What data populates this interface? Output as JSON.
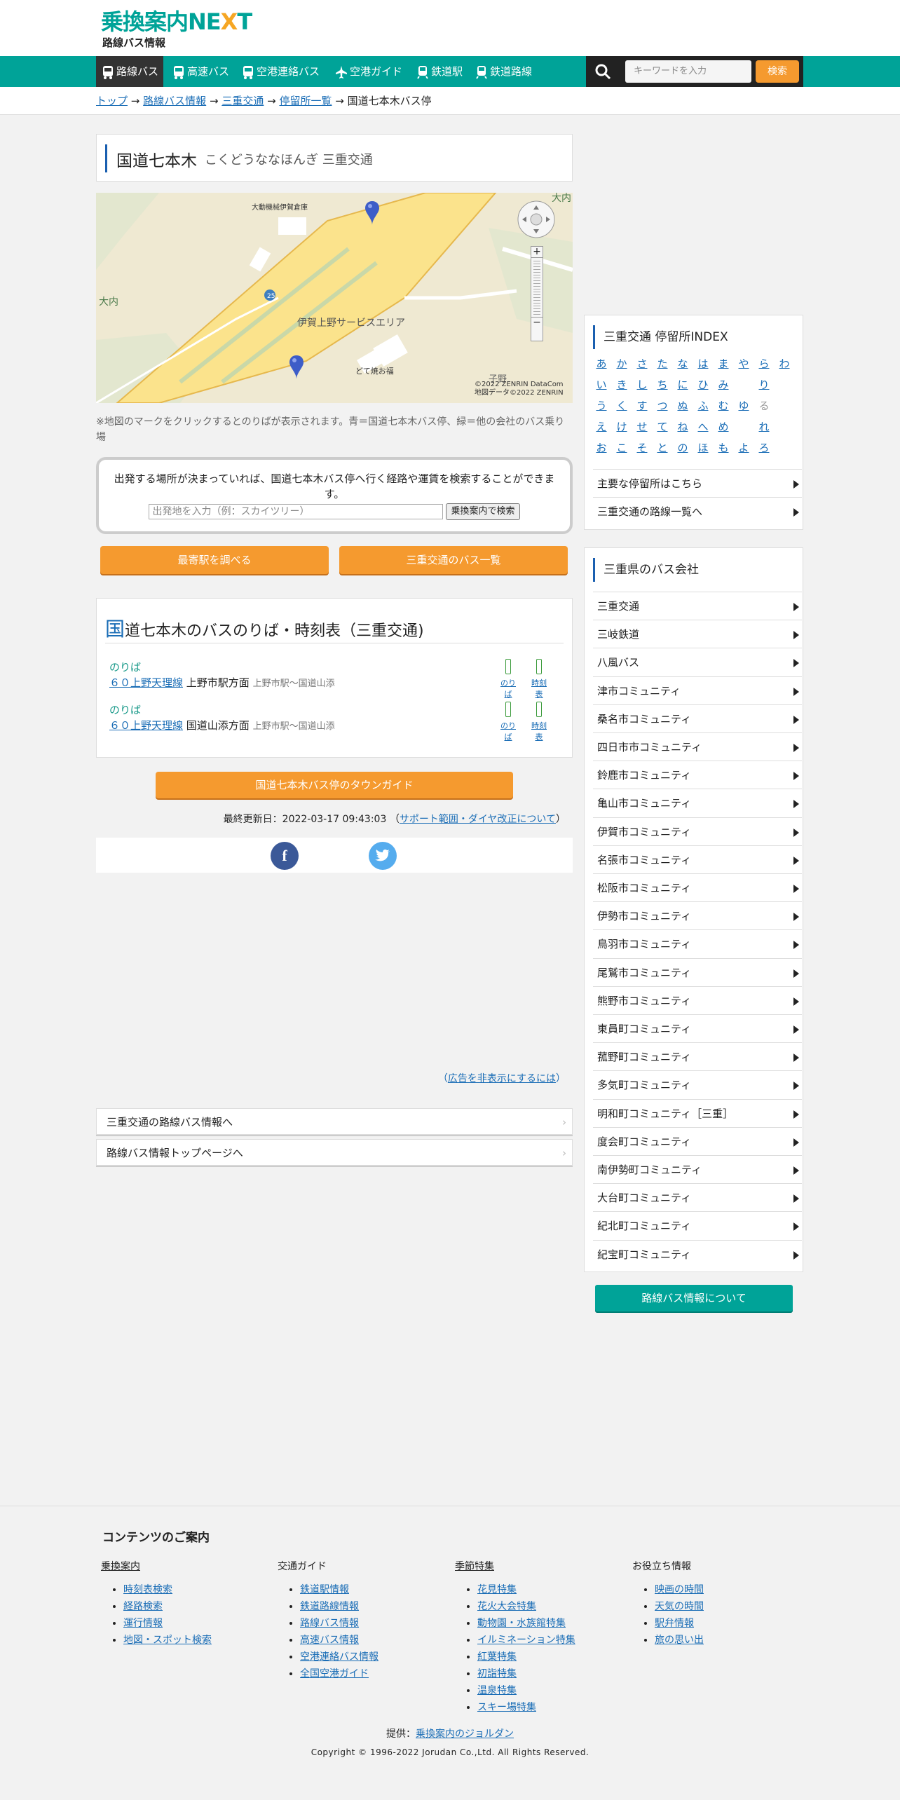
{
  "header": {
    "logo_text": "乗換案内",
    "logo_next": "NE",
    "logo_x": "X",
    "logo_t": "T",
    "subtitle": "路線バス情報"
  },
  "nav": {
    "items": [
      {
        "label": "路線バス",
        "icon": "bus-icon"
      },
      {
        "label": "高速バス",
        "icon": "highway-bus-icon"
      },
      {
        "label": "空港連絡バス",
        "icon": "airport-bus-icon"
      },
      {
        "label": "空港ガイド",
        "icon": "airplane-icon"
      },
      {
        "label": "鉄道駅",
        "icon": "train-icon"
      },
      {
        "label": "鉄道路線",
        "icon": "rail-line-icon"
      }
    ],
    "search_placeholder": "キーワードを入力",
    "search_button": "検索"
  },
  "breadcrumb": {
    "items": [
      "トップ",
      "路線バス情報",
      "三重交通",
      "停留所一覧"
    ],
    "sep": "→",
    "current": "国道七本木バス停"
  },
  "stop": {
    "name": "国道七本木",
    "reading": "こくどうななほんぎ 三重交通"
  },
  "map": {
    "labels": [
      "大内",
      "大内",
      "大動機械伊賀倉庫",
      "伊賀上野サービスエリア",
      "どて焼お福",
      "25",
      "子野"
    ],
    "copyright1": "©2022 ZENRIN DataCom",
    "copyright2": "地図データ©2022 ZENRIN"
  },
  "map_note": "※地図のマークをクリックするとのりばが表示されます。青＝国道七本木バス停、緑＝他の会社のバス乗り場",
  "route_search": {
    "message": "出発する場所が決まっていれば、国道七本木バス停へ行く経路や運賃を検索することができます。",
    "placeholder": "出発地を入力（例：スカイツリー）",
    "button": "乗換案内で検索"
  },
  "buttons": {
    "nearest_station": "最寄駅を調べる",
    "bus_list": "三重交通のバス一覧"
  },
  "timetable": {
    "heading_initial": "国",
    "heading_rest": "道七本木のバスのりば・時刻表（三重交通)",
    "rows": [
      {
        "label": "のりば",
        "route": "６０上野天理線",
        "direction": "上野市駅方面",
        "range": "上野市駅～国道山添",
        "link1": "のりば",
        "link2": "時刻表"
      },
      {
        "label": "のりば",
        "route": "６０上野天理線",
        "direction": "国道山添方面",
        "range": "上野市駅～国道山添",
        "link1": "のりば",
        "link2": "時刻表"
      }
    ]
  },
  "town_guide": "国道七本木バス停のタウンガイド",
  "updated": {
    "text": "最終更新日：2022-03-17 09:43:03",
    "open": "（",
    "link": "サポート範囲・ダイヤ改正について",
    "close": "）"
  },
  "social": {
    "facebook": "f",
    "twitter": "t"
  },
  "ad_note": {
    "open": "（",
    "link": "広告を非表示にするには",
    "close": "）"
  },
  "bottom_links": [
    "三重交通の路線バス情報へ",
    "路線バス情報トップページへ"
  ],
  "sidebar_index": {
    "title": "三重交通 停留所INDEX",
    "kana_columns": [
      [
        "あ",
        "い",
        "う",
        "え",
        "お"
      ],
      [
        "か",
        "き",
        "く",
        "け",
        "こ"
      ],
      [
        "さ",
        "し",
        "す",
        "せ",
        "そ"
      ],
      [
        "た",
        "ち",
        "つ",
        "て",
        "と"
      ],
      [
        "な",
        "に",
        "ぬ",
        "ね",
        "の"
      ],
      [
        "は",
        "ひ",
        "ふ",
        "へ",
        "ほ"
      ],
      [
        "ま",
        "み",
        "む",
        "め",
        "も"
      ],
      [
        "や",
        "",
        "ゆ",
        "",
        "よ"
      ],
      [
        "ら",
        "り",
        "る",
        "れ",
        "ろ"
      ],
      [
        "わ",
        "",
        "",
        "",
        ""
      ]
    ],
    "links": [
      "主要な停留所はこちら",
      "三重交通の路線一覧へ"
    ]
  },
  "sidebar_companies": {
    "title": "三重県のバス会社",
    "items": [
      "三重交通",
      "三岐鉄道",
      "八風バス",
      "津市コミュニティ",
      "桑名市コミュニティ",
      "四日市市コミュニティ",
      "鈴鹿市コミュニティ",
      "亀山市コミュニティ",
      "伊賀市コミュニティ",
      "名張市コミュニティ",
      "松阪市コミュニティ",
      "伊勢市コミュニティ",
      "鳥羽市コミュニティ",
      "尾鷲市コミュニティ",
      "熊野市コミュニティ",
      "東員町コミュニティ",
      "菰野町コミュニティ",
      "多気町コミュニティ",
      "明和町コミュニティ［三重］",
      "度会町コミュニティ",
      "南伊勢町コミュニティ",
      "大台町コミュニティ",
      "紀北町コミュニティ",
      "紀宝町コミュニティ"
    ]
  },
  "about_button": "路線バス情報について",
  "footer": {
    "heading": "コンテンツのご案内",
    "columns": [
      {
        "title": "乗換案内",
        "items": [
          "時刻表検索",
          "経路検索",
          "運行情報",
          "地図・スポット検索"
        ]
      },
      {
        "title": "交通ガイド",
        "items": [
          "鉄道駅情報",
          "鉄道路線情報",
          "路線バス情報",
          "高速バス情報",
          "空港連絡バス情報",
          "全国空港ガイド"
        ]
      },
      {
        "title": "季節特集",
        "items": [
          "花見特集",
          "花火大会特集",
          "動物園・水族館特集",
          "イルミネーション特集",
          "紅葉特集",
          "初詣特集",
          "温泉特集",
          "スキー場特集"
        ]
      },
      {
        "title": "お役立ち情報",
        "items": [
          "映画の時間",
          "天気の時間",
          "駅弁情報",
          "旅の思い出"
        ]
      }
    ],
    "provider_label": "提供：",
    "provider_link": "乗換案内のジョルダン",
    "copyright": "Copyright © 1996-2022 Jorudan Co.,Ltd. All Rights Reserved."
  },
  "colors": {
    "brand": "#00a398",
    "accent": "#f59a2f",
    "link": "#1a6db6"
  }
}
